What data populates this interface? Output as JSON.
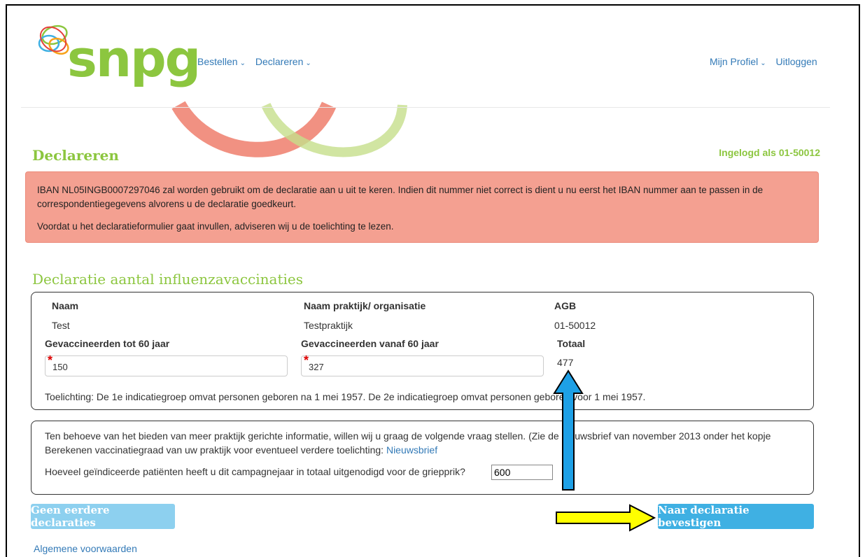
{
  "brand": {
    "name": "snpg",
    "green": "#8cc63f",
    "blue": "#337ab7"
  },
  "nav": {
    "left": [
      {
        "label": "Bestellen"
      },
      {
        "label": "Declareren"
      }
    ],
    "profile": "Mijn Profiel",
    "logout": "Uitloggen"
  },
  "page": {
    "title": "Declareren",
    "logged_in": "Ingelogd als 01-50012"
  },
  "alert": {
    "line1": "IBAN NL05INGB0007297046 zal worden gebruikt om de declaratie aan u uit te keren. Indien dit nummer niet correct is dient u nu eerst het IBAN nummer aan te passen in de correspondentiegegevens alvorens u de declaratie goedkeurt.",
    "line2": "Voordat u het declaratieformulier gaat invullen, adviseren wij u de toelichting te lezen.",
    "color": "#f4a091"
  },
  "section": {
    "title": "Declaratie aantal influenzavaccinaties",
    "naam_label": "Naam",
    "naam_value": "Test",
    "praktijk_label": "Naam praktijk/ organisatie",
    "praktijk_value": "Testpraktijk",
    "agb_label": "AGB",
    "agb_value": "01-50012",
    "tot60_label": "Gevaccineerden tot 60 jaar",
    "tot60_value": "150",
    "vanaf60_label": "Gevaccineerden vanaf 60 jaar",
    "vanaf60_value": "327",
    "totaal_label": "Totaal",
    "totaal_value": "477",
    "toelichting": "Toelichting: De 1e indicatiegroep omvat personen geboren na 1 mei 1957. De 2e indicatiegroep omvat personen geboren voor 1 mei 1957."
  },
  "extra": {
    "text": "Ten behoeve van het bieden van meer praktijk gerichte informatie, willen wij u graag de volgende vraag stellen. (Zie de nieuwsbrief van november 2013 onder het kopje Berekenen vaccinatiegraad van uw praktijk voor eventueel verdere toelichting:",
    "link": "Nieuwsbrief",
    "question": "Hoeveel geïndiceerde patiënten heeft u dit campagnejaar in totaal uitgenodigd voor de griepprik?",
    "answer": "600"
  },
  "buttons": {
    "previous": "Geen eerdere declaraties",
    "next": "Naar declaratie bevestigen"
  },
  "footer": {
    "terms": "Algemene voorwaarden"
  },
  "annotations": {
    "arrow_up_color": "#1ea0e6",
    "arrow_right_color": "#ffff00"
  }
}
